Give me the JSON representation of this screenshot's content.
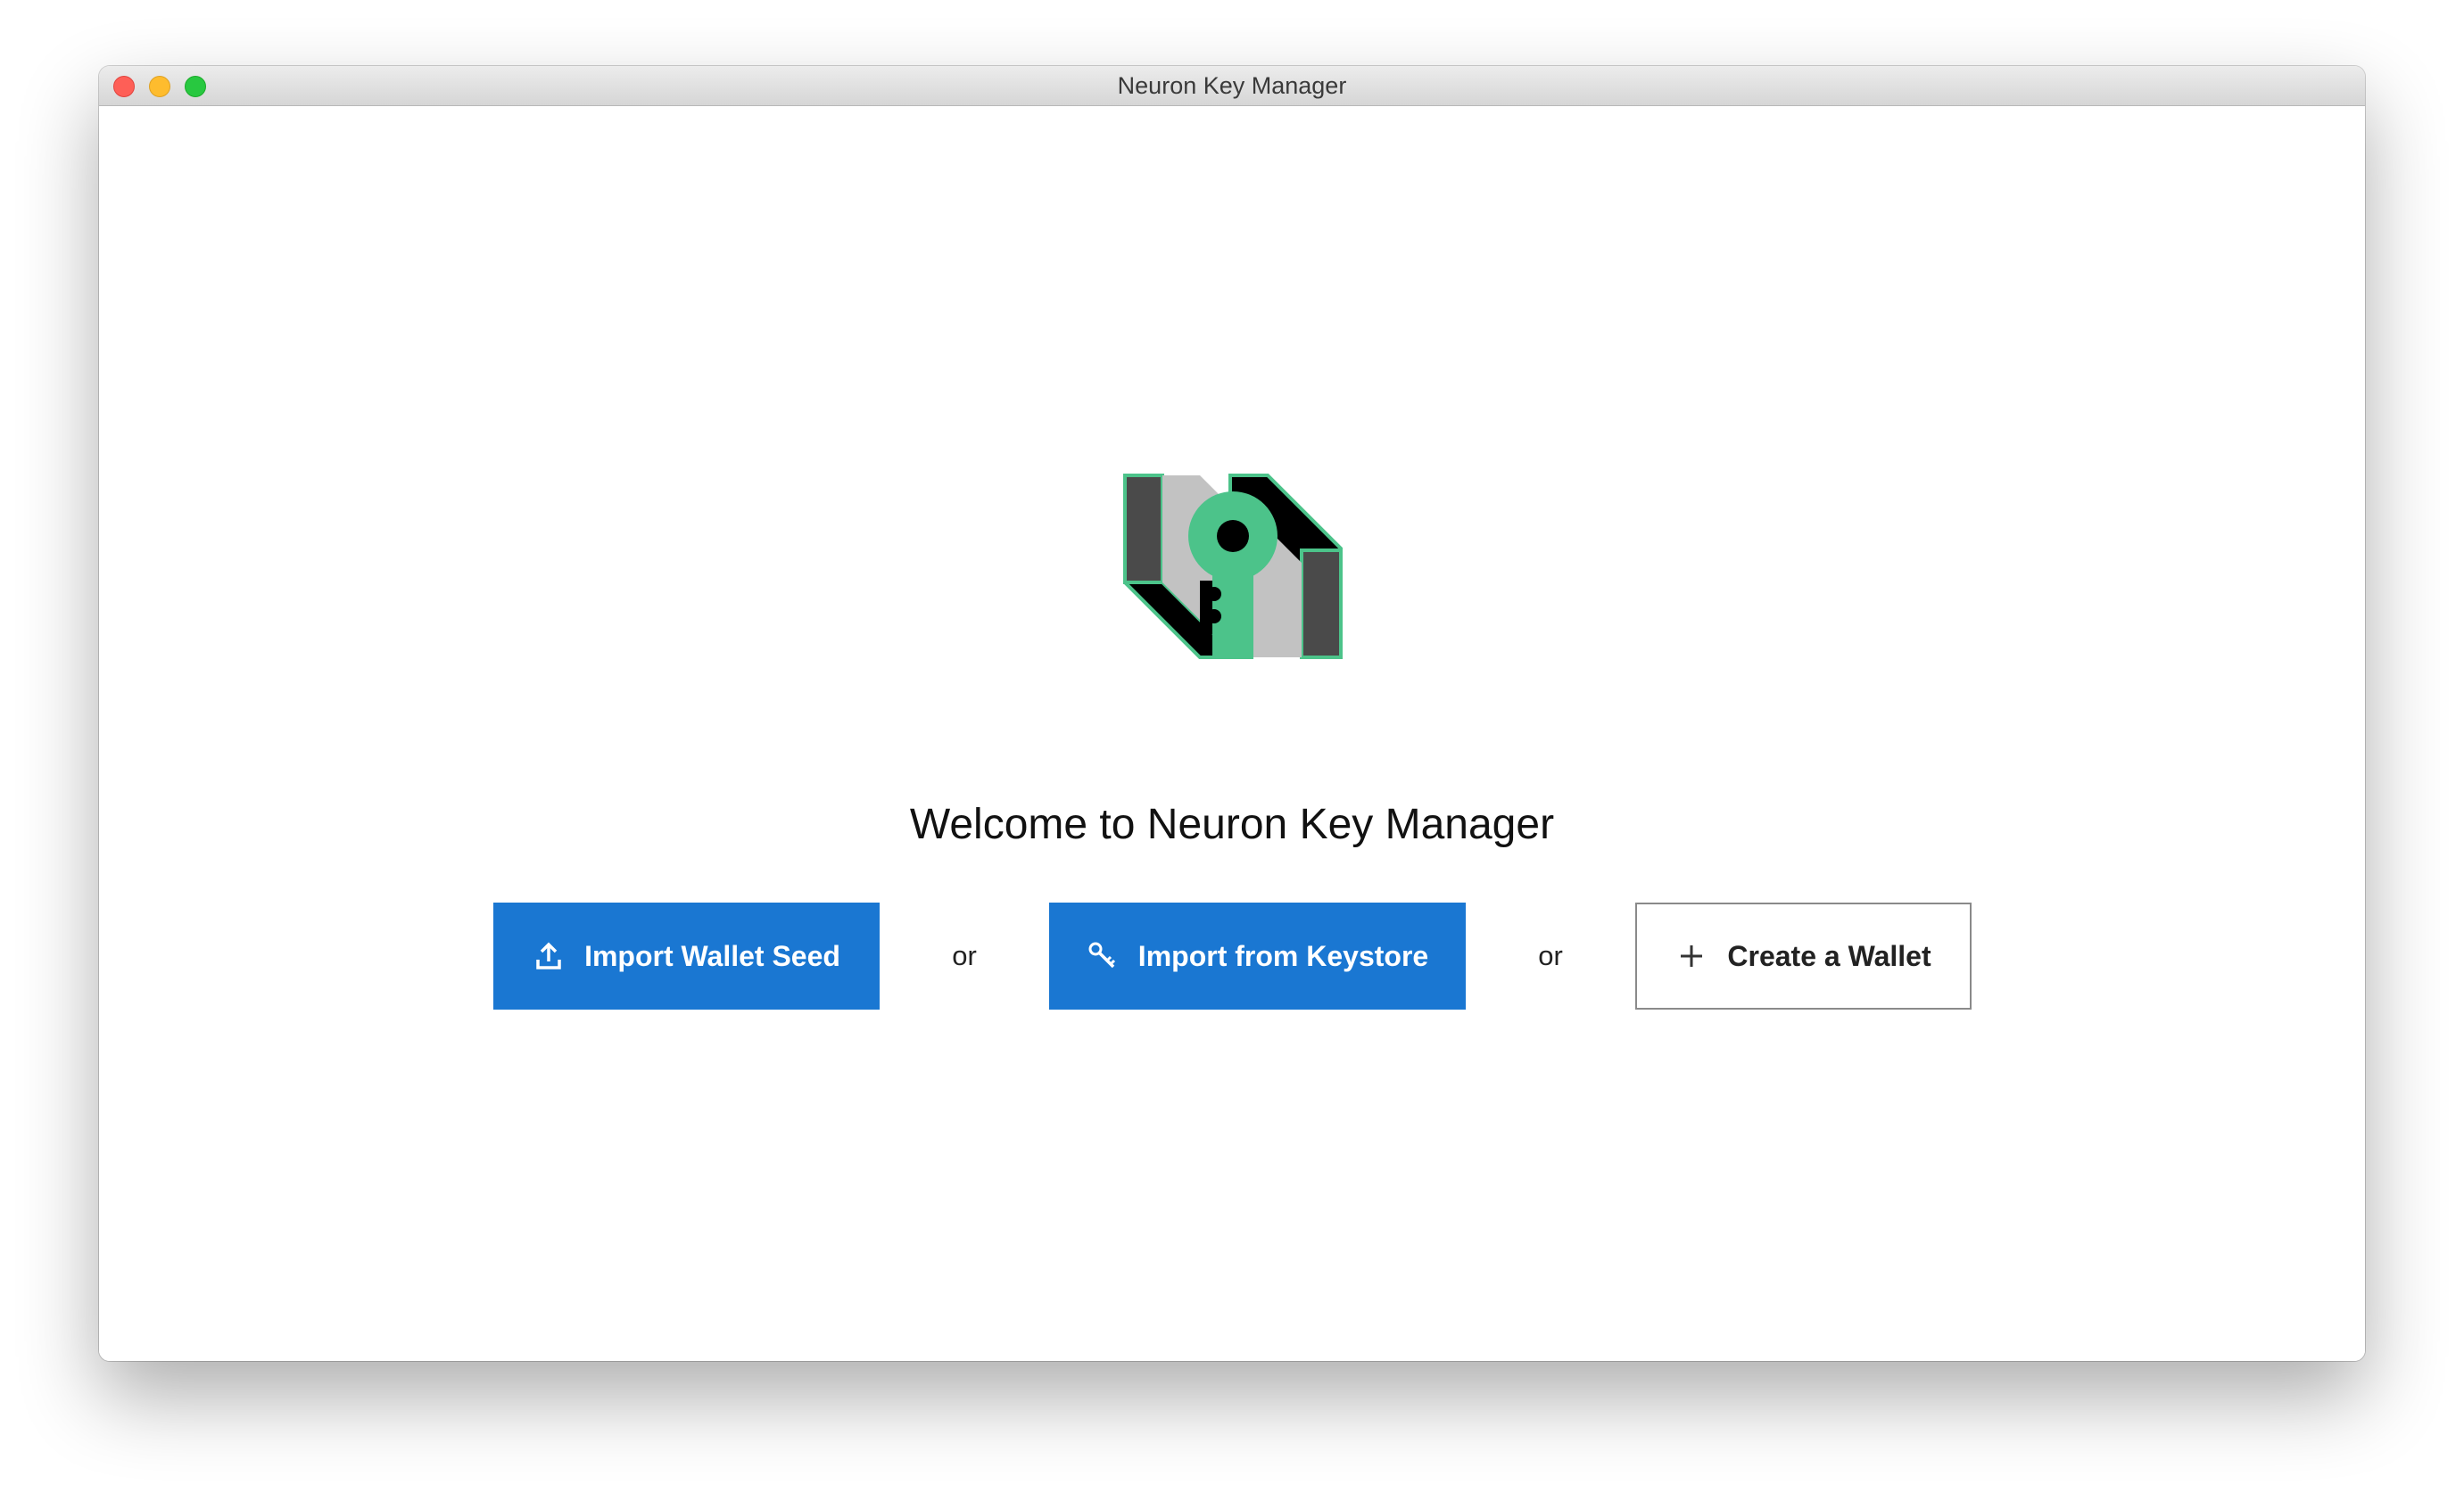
{
  "window": {
    "title": "Neuron Key Manager"
  },
  "main": {
    "welcome": "Welcome to Neuron Key Manager",
    "separator": "or",
    "buttons": {
      "import_seed": "Import Wallet Seed",
      "import_keystore": "Import from Keystore",
      "create_wallet": "Create a Wallet"
    }
  },
  "icons": {
    "import_seed": "upload-icon",
    "import_keystore": "key-icon",
    "create_wallet": "plus-icon",
    "logo": "neuron-key-logo"
  },
  "colors": {
    "primary": "#1a77d2",
    "logo_green": "#4cc38a"
  }
}
